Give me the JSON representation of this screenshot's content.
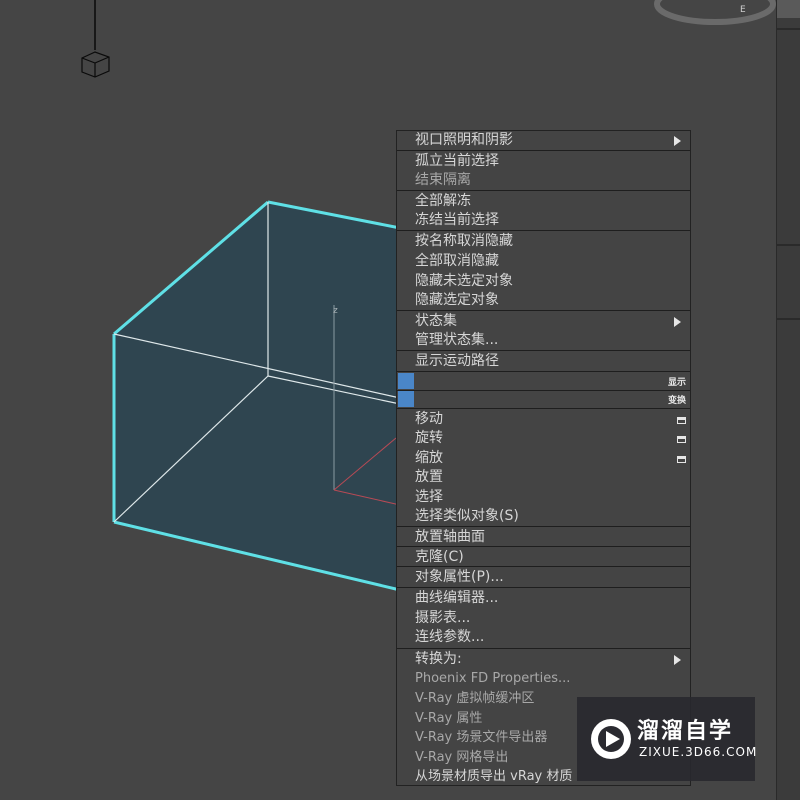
{
  "menu": {
    "items": [
      {
        "label": "视口照明和阴影",
        "has_submenu": true
      },
      {
        "label": "孤立当前选择"
      },
      {
        "label": "结束隔离",
        "disabled": true
      },
      {
        "label": "全部解冻"
      },
      {
        "label": "冻结当前选择"
      },
      {
        "label": "按名称取消隐藏"
      },
      {
        "label": "全部取消隐藏"
      },
      {
        "label": "隐藏未选定对象"
      },
      {
        "label": "隐藏选定对象"
      },
      {
        "label": "状态集",
        "has_submenu": true
      },
      {
        "label": "管理状态集..."
      },
      {
        "label": "显示运动路径"
      },
      {
        "label": "移动",
        "has_options": true
      },
      {
        "label": "旋转",
        "has_options": true
      },
      {
        "label": "缩放",
        "has_options": true
      },
      {
        "label": "放置"
      },
      {
        "label": "选择"
      },
      {
        "label": "选择类似对象(S)"
      },
      {
        "label": "放置轴曲面"
      },
      {
        "label": "克隆(C)"
      },
      {
        "label": "对象属性(P)..."
      },
      {
        "label": "曲线编辑器..."
      },
      {
        "label": "摄影表..."
      },
      {
        "label": "连线参数..."
      },
      {
        "label": "转换为:",
        "has_submenu": true
      },
      {
        "label": "Phoenix FD Properties..."
      },
      {
        "label": "V-Ray 虚拟帧缓冲区"
      },
      {
        "label": "V-Ray 属性"
      },
      {
        "label": "V-Ray 场景文件导出器"
      },
      {
        "label": "V-Ray 网格导出"
      },
      {
        "label": "从场景材质导出 vRay 材质"
      }
    ],
    "quad_labels": {
      "display": "显示",
      "transform": "变换"
    }
  },
  "viewport": {
    "axis_label": "z",
    "selection_color": "#5fe0e6",
    "box_fill": "#2f4550"
  },
  "watermark": {
    "title": "溜溜自学",
    "url": "ZIXUE.3D66.COM"
  },
  "annotation": {
    "arrow_color": "#e02020"
  }
}
